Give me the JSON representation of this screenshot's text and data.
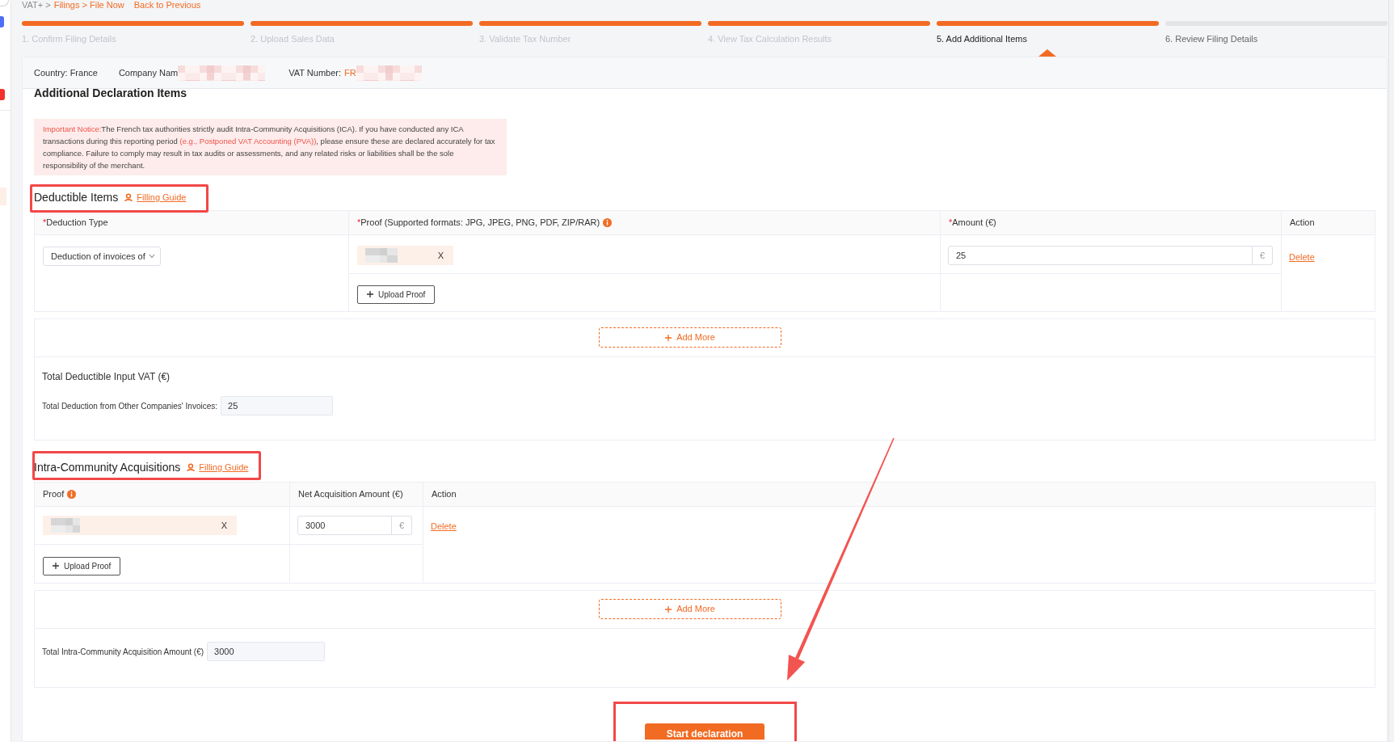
{
  "breadcrumb": {
    "segments": [
      {
        "text": "VAT+ >",
        "kind": "muted"
      },
      {
        "text": "Filings > File Now",
        "kind": "link"
      }
    ],
    "back_link": "Back to Previous"
  },
  "steps": [
    {
      "label": "1. Confirm Filing Details",
      "completed": true,
      "selected": false
    },
    {
      "label": "2. Upload Sales Data",
      "completed": true,
      "selected": false
    },
    {
      "label": "3. Validate Tax Number",
      "completed": true,
      "selected": false
    },
    {
      "label": "4. View Tax Calculation Results",
      "completed": true,
      "selected": false
    },
    {
      "label": "5. Add Additional Items",
      "completed": true,
      "selected": true
    },
    {
      "label": "6. Review Filing Details",
      "completed": false,
      "selected": false
    }
  ],
  "filing_info": {
    "country": "Country: France",
    "company_name": {
      "label": "Company Nam",
      "redacted": true
    },
    "vat_number": {
      "label": "VAT Number:",
      "value": "FR",
      "redacted": true
    }
  },
  "title": "Additional Declaration Items",
  "notice": {
    "segments": [
      {
        "text": "Important Notice:",
        "kind": "alert"
      },
      {
        "text": "The French tax authorities strictly audit Intra-Community Acquisitions (ICA). If you have conducted any ICA transactions during this reporting period ",
        "kind": "plain"
      },
      {
        "text": "(e.g., Postponed VAT Accounting (PVA))",
        "kind": "alert"
      },
      {
        "text": ", please ensure these are declared accurately for tax compliance. Failure to comply may result in tax audits or assessments, and any related risks or liabilities shall be the sole responsibility of the merchant.",
        "kind": "plain"
      }
    ]
  },
  "deductible_items": {
    "heading": "Deductible Items",
    "highlighted": true,
    "guide_link": "Filling Guide",
    "columns": [
      {
        "kind": "select",
        "required_mark": "*",
        "label": "Deduction Type"
      },
      {
        "kind": "proof",
        "required_mark": "*",
        "label": "Proof (Supported formats: JPG, JPEG, PNG, PDF, ZIP/RAR)",
        "info": true
      },
      {
        "kind": "amount",
        "required_mark": "*",
        "label": "Amount (€)"
      },
      {
        "kind": "action",
        "label": "Action"
      }
    ],
    "rows": [
      {
        "deduction_type": "Deduction of invoices of",
        "proofs": [
          {
            "name_redacted": true,
            "remove": "X"
          }
        ],
        "upload_label": "Upload Proof",
        "amount": "25",
        "currency": "€",
        "action": "Delete"
      }
    ],
    "add_more": "Add More",
    "totals_title": "Total Deductible Input VAT (€)",
    "totals": [
      {
        "label": "Total Deduction from Other Companies' Invoices:",
        "value": "25"
      }
    ]
  },
  "intra_community_acquisitions": {
    "heading": "Intra-Community Acquisitions",
    "highlighted": true,
    "guide_link": "Filling Guide",
    "columns": [
      {
        "kind": "proof",
        "label": "Proof",
        "info": true
      },
      {
        "kind": "amount",
        "label": "Net Acquisition Amount (€)"
      },
      {
        "kind": "action",
        "label": "Action"
      }
    ],
    "rows": [
      {
        "proofs": [
          {
            "name_redacted": true,
            "remove": "X"
          }
        ],
        "upload_label": "Upload Proof",
        "amount": "3000",
        "currency": "€",
        "action": "Delete"
      }
    ],
    "add_more": "Add More",
    "totals": [
      {
        "label": "Total Intra-Community Acquisition Amount (€)",
        "value": "3000"
      }
    ]
  },
  "submit": {
    "label": "Start declaration",
    "highlighted": true
  }
}
